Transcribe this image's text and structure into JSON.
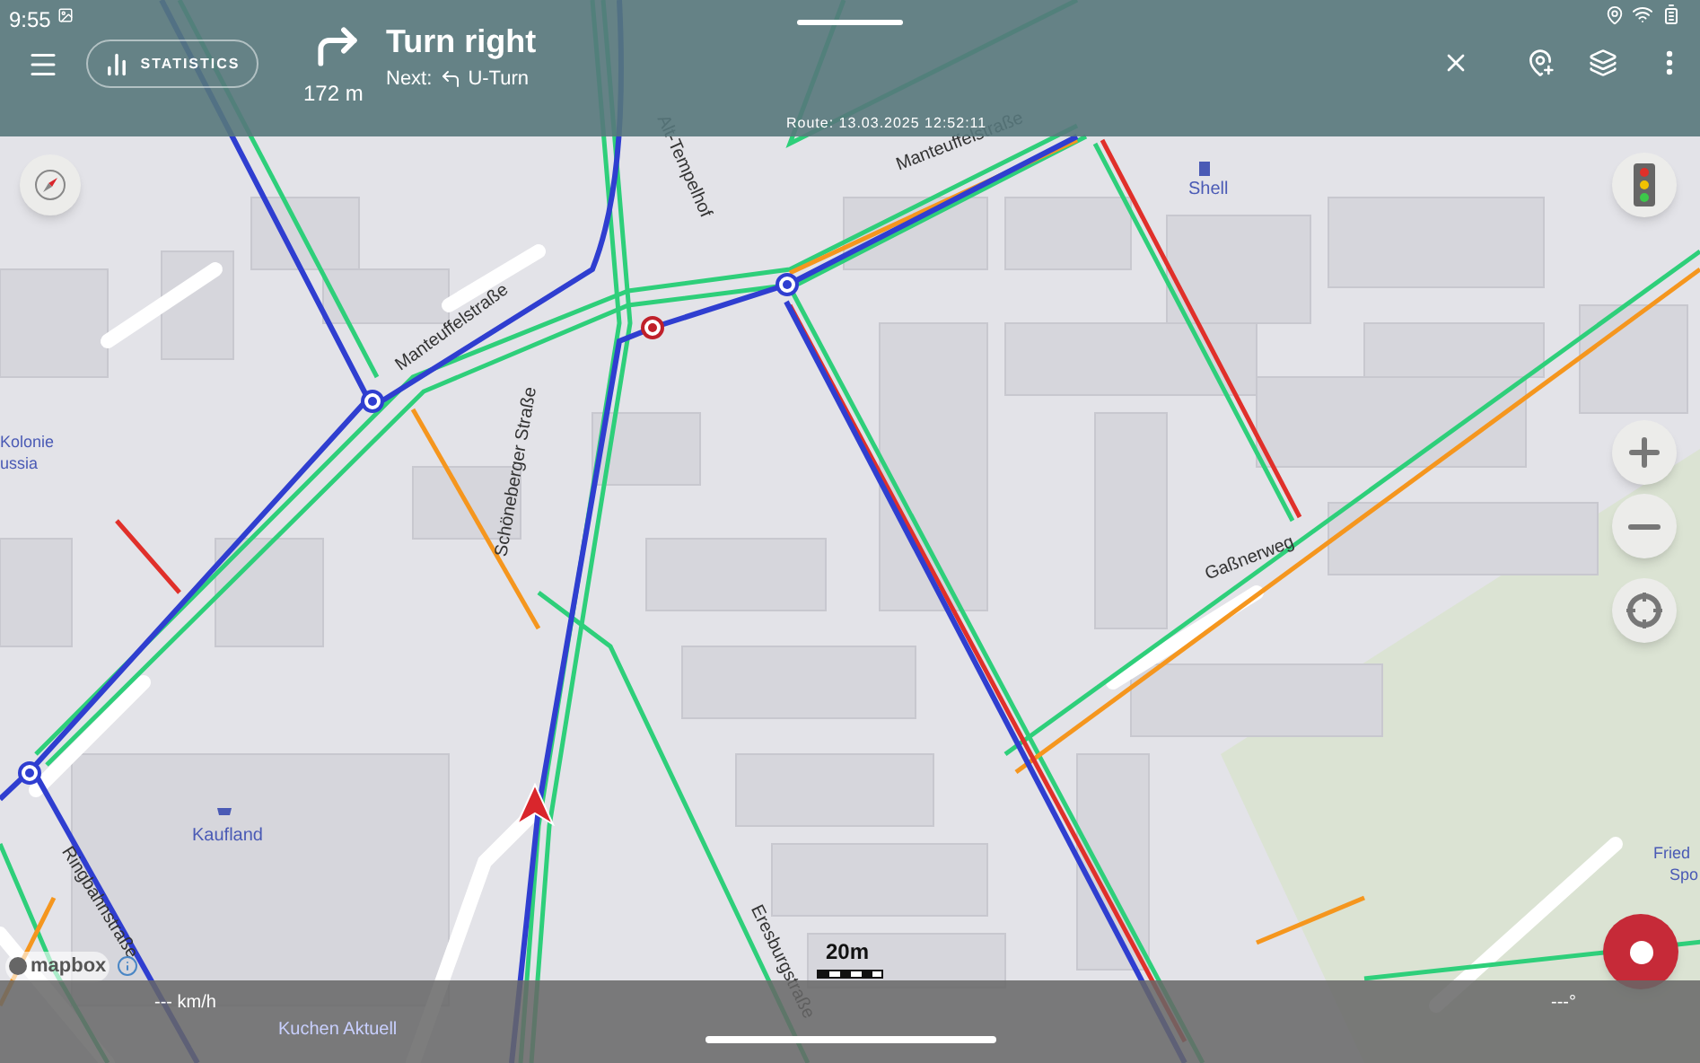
{
  "status_bar": {
    "time": "9:55"
  },
  "toolbar": {
    "statistics_label": "STATISTICS"
  },
  "navigation": {
    "instruction": "Turn right",
    "distance": "172 m",
    "next_label": "Next:",
    "next_instruction": "U-Turn"
  },
  "route_label": "Route: 13.03.2025 12:52:11",
  "map_labels": [
    {
      "text": "Manteuffelstraße",
      "kind": "street"
    },
    {
      "text": "Manteuffelstraße",
      "kind": "street"
    },
    {
      "text": "Alt-Tempelhof",
      "kind": "street"
    },
    {
      "text": "Schöneberger Straße",
      "kind": "street"
    },
    {
      "text": "Gaßnerweg",
      "kind": "street"
    },
    {
      "text": "Ringbahnstraße",
      "kind": "street"
    },
    {
      "text": "Eresburgstraße",
      "kind": "street"
    },
    {
      "text": "Shell",
      "kind": "poi"
    },
    {
      "text": "Kaufland",
      "kind": "poi"
    },
    {
      "text": "Kuchen Aktuell",
      "kind": "poi"
    },
    {
      "text": "Kolonie",
      "kind": "place"
    },
    {
      "text": "ussia",
      "kind": "place"
    },
    {
      "text": "Fried",
      "kind": "place"
    },
    {
      "text": "Spo",
      "kind": "place"
    }
  ],
  "scale": "20m",
  "attribution": "mapbox",
  "bottom_bar": {
    "speed": "--- km/h",
    "heading": "---°"
  }
}
